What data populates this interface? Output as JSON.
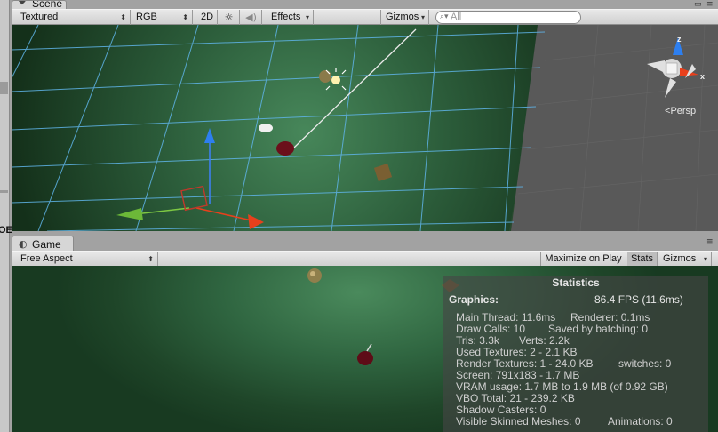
{
  "scene_panel": {
    "tab_label": "Scene",
    "tab_icon": "scene-tab-icon",
    "toolbar": {
      "draw_mode": "Textured",
      "render_mode": "RGB",
      "mode_2d": "2D",
      "lighting_icon": "sun-icon",
      "audio_icon": "speaker-icon",
      "effects": "Effects",
      "gizmos": "Gizmos",
      "search_placeholder": "All"
    },
    "view": {
      "orientation": "Persp",
      "axes": {
        "z": "z",
        "x": "x"
      }
    }
  },
  "side_panel_fragment": "OE",
  "game_panel": {
    "tab_label": "Game",
    "tab_icon": "game-tab-icon",
    "toolbar": {
      "aspect": "Free Aspect",
      "maximize_on_play": "Maximize on Play",
      "stats": "Stats",
      "gizmos": "Gizmos"
    },
    "stats": {
      "title": "Statistics",
      "heading": "Graphics:",
      "fps": "86.4 FPS (11.6ms)",
      "rows": [
        {
          "a": "Main Thread: 11.6ms",
          "b": "Renderer: 0.1ms"
        },
        {
          "a": "Draw Calls: 10",
          "b": "Saved by batching: 0"
        },
        {
          "a": "Tris: 3.3k",
          "b": "Verts: 2.2k"
        },
        {
          "a": "Used Textures: 2 - 2.1 KB",
          "b": ""
        },
        {
          "a": "Render Textures: 1 - 24.0 KB",
          "b": "switches: 0"
        },
        {
          "a": "Screen: 791x183 - 1.7 MB",
          "b": ""
        },
        {
          "a": "VRAM usage: 1.7 MB to 1.9 MB (of 0.92 GB)",
          "b": ""
        },
        {
          "a": "VBO Total: 21 - 239.2 KB",
          "b": ""
        },
        {
          "a": "Shadow Casters: 0",
          "b": ""
        },
        {
          "a": "Visible Skinned Meshes: 0",
          "b": "Animations: 0"
        }
      ]
    }
  },
  "colors": {
    "grid_line": "#5fb4e8",
    "ground_green": "#2f6540",
    "gizmo_x": "#e8401c",
    "gizmo_y": "#7ec843",
    "gizmo_z": "#2d7ff0"
  }
}
